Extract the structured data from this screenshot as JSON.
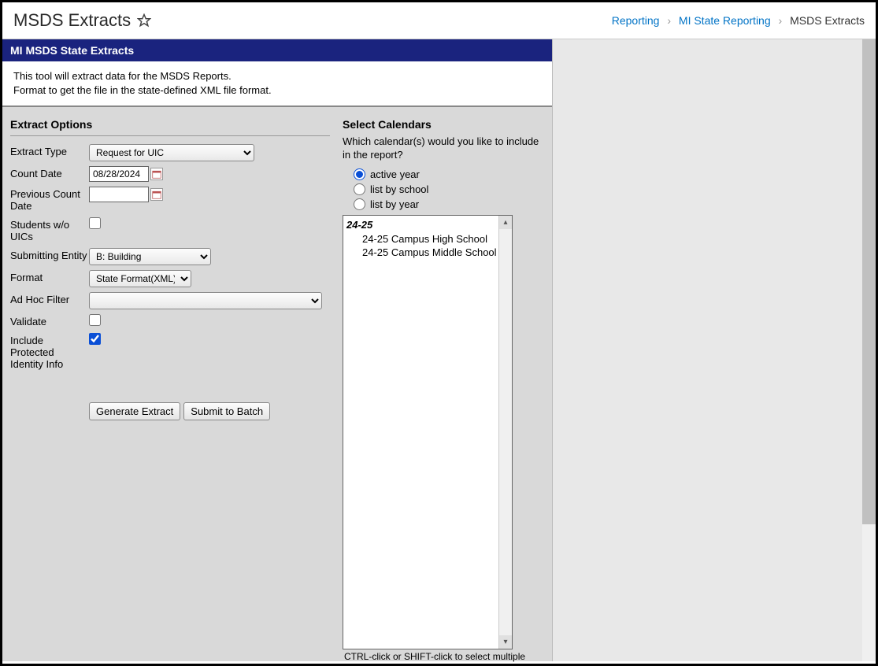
{
  "header": {
    "title": "MSDS Extracts",
    "breadcrumb": {
      "items": [
        "Reporting",
        "MI State Reporting"
      ],
      "current": "MSDS Extracts"
    }
  },
  "panel": {
    "title": "MI MSDS State Extracts",
    "desc_line1": "This tool will extract data for the MSDS Reports.",
    "desc_line2": "Format to get the file in the state-defined XML file format."
  },
  "extract": {
    "section_title": "Extract Options",
    "labels": {
      "extract_type": "Extract Type",
      "count_date": "Count Date",
      "prev_count_date": "Previous Count Date",
      "students_wo_uics": "Students w/o UICs",
      "submitting_entity": "Submitting Entity",
      "format": "Format",
      "adhoc": "Ad Hoc Filter",
      "validate": "Validate",
      "include_protected": "Include Protected Identity Info"
    },
    "values": {
      "extract_type": "Request for UIC",
      "count_date": "08/28/2024",
      "prev_count_date": "",
      "students_wo_uics": false,
      "submitting_entity": "B: Building",
      "format": "State Format(XML)",
      "adhoc": "",
      "validate": false,
      "include_protected": true
    },
    "buttons": {
      "generate": "Generate Extract",
      "submit_batch": "Submit to Batch"
    }
  },
  "calendars": {
    "section_title": "Select Calendars",
    "desc": "Which calendar(s) would you like to include in the report?",
    "radios": {
      "active_year": "active year",
      "by_school": "list by school",
      "by_year": "list by year",
      "selected": "active_year"
    },
    "list": {
      "year_header": "24-25",
      "items": [
        "24-25 Campus High School",
        "24-25 Campus Middle School"
      ]
    },
    "hint": "CTRL-click or SHIFT-click to select multiple"
  }
}
